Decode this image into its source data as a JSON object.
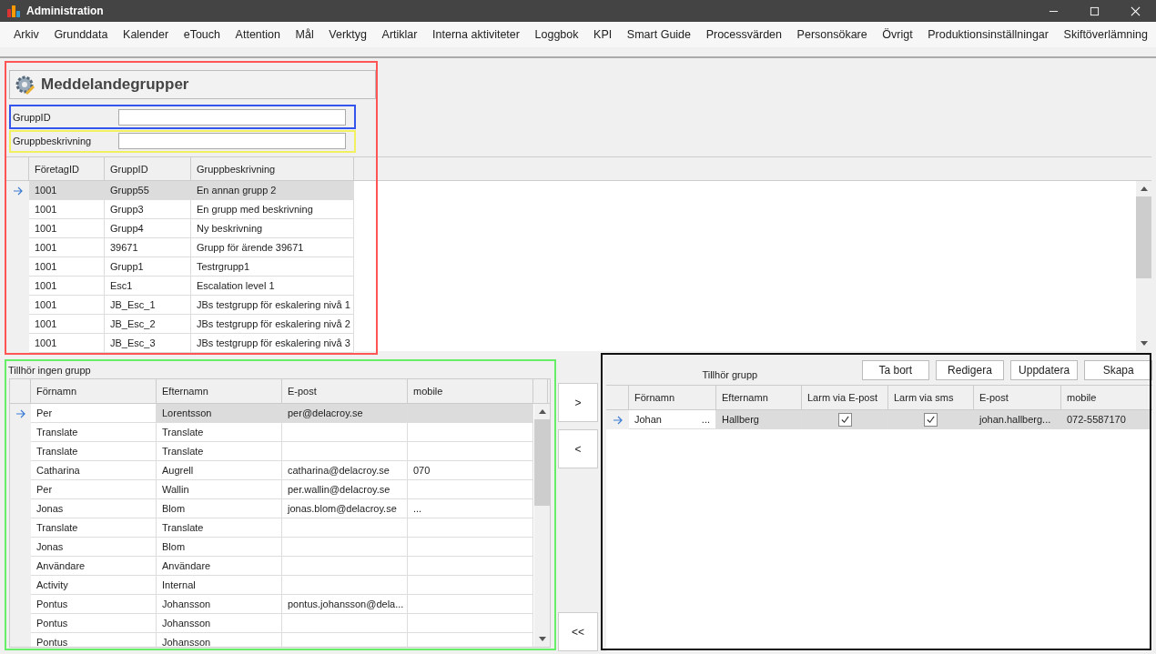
{
  "window": {
    "title": "Administration"
  },
  "menu": [
    "Arkiv",
    "Grunddata",
    "Kalender",
    "eTouch",
    "Attention",
    "Mål",
    "Verktyg",
    "Artiklar",
    "Interna aktiviteter",
    "Loggbok",
    "KPI",
    "Smart Guide",
    "Processvärden",
    "Personsökare",
    "Övrigt",
    "Produktionsinställningar",
    "Skiftöverlämning"
  ],
  "header": {
    "title": "Meddelandegrupper"
  },
  "fields": [
    {
      "label": "GruppID"
    },
    {
      "label": "Gruppbeskrivning"
    }
  ],
  "groups_table": {
    "columns": [
      "FöretagID",
      "GruppID",
      "Gruppbeskrivning"
    ],
    "rows": [
      {
        "selected": true,
        "cells": [
          "1001",
          "Grupp55",
          "En annan grupp 2"
        ]
      },
      {
        "selected": false,
        "cells": [
          "1001",
          "Grupp3",
          "En grupp med beskrivning"
        ]
      },
      {
        "selected": false,
        "cells": [
          "1001",
          "Grupp4",
          "Ny beskrivning"
        ]
      },
      {
        "selected": false,
        "cells": [
          "1001",
          "39671",
          "Grupp för ärende 39671"
        ]
      },
      {
        "selected": false,
        "cells": [
          "1001",
          "Grupp1",
          "Testrgrupp1"
        ]
      },
      {
        "selected": false,
        "cells": [
          "1001",
          "Esc1",
          "Escalation level 1"
        ]
      },
      {
        "selected": false,
        "cells": [
          "1001",
          "JB_Esc_1",
          "JBs testgrupp för eskalering nivå 1"
        ]
      },
      {
        "selected": false,
        "cells": [
          "1001",
          "JB_Esc_2",
          "JBs testgrupp för eskalering nivå 2"
        ]
      },
      {
        "selected": false,
        "cells": [
          "1001",
          "JB_Esc_3",
          "JBs testgrupp för eskalering nivå 3"
        ]
      }
    ]
  },
  "ungrouped": {
    "title": "Tillhör ingen grupp",
    "columns": [
      "Förnamn",
      "Efternamn",
      "E-post",
      "mobile"
    ],
    "rows": [
      {
        "selected": true,
        "cells": [
          "Per",
          "Lorentsson",
          "per@delacroy.se",
          ""
        ]
      },
      {
        "selected": false,
        "cells": [
          "Translate",
          "Translate",
          "",
          ""
        ]
      },
      {
        "selected": false,
        "cells": [
          "Translate",
          "Translate",
          "",
          ""
        ]
      },
      {
        "selected": false,
        "cells": [
          "Catharina",
          "Augrell",
          "catharina@delacroy.se",
          "070"
        ]
      },
      {
        "selected": false,
        "cells": [
          "Per",
          "Wallin",
          "per.wallin@delacroy.se",
          ""
        ]
      },
      {
        "selected": false,
        "cells": [
          "Jonas",
          "Blom",
          "jonas.blom@delacroy.se",
          {
            "button": "..."
          }
        ]
      },
      {
        "selected": false,
        "cells": [
          "Translate",
          "Translate",
          "",
          ""
        ]
      },
      {
        "selected": false,
        "cells": [
          "Jonas",
          "Blom",
          "",
          ""
        ]
      },
      {
        "selected": false,
        "cells": [
          "Användare",
          "Användare",
          "",
          ""
        ]
      },
      {
        "selected": false,
        "cells": [
          "Activity",
          "Internal",
          "",
          ""
        ]
      },
      {
        "selected": false,
        "cells": [
          "Pontus",
          "Johansson",
          "pontus.johansson@dela...",
          ""
        ]
      },
      {
        "selected": false,
        "cells": [
          "Pontus",
          "Johansson",
          "",
          ""
        ]
      },
      {
        "selected": false,
        "cells": [
          "Pontus",
          "Johansson",
          "",
          ""
        ]
      }
    ]
  },
  "move_buttons": [
    ">",
    "<",
    "<<"
  ],
  "grouped": {
    "title": "Tillhör grupp",
    "buttons": [
      "Ta bort",
      "Redigera",
      "Uppdatera",
      "Skapa"
    ],
    "columns": [
      "Förnamn",
      "Efternamn",
      "Larm via E-post",
      "Larm via sms",
      "E-post",
      "mobile"
    ],
    "rows": [
      {
        "selected": true,
        "cells": [
          {
            "text": "Johan",
            "button": "..."
          },
          "Hallberg",
          {
            "checked": true
          },
          {
            "checked": true
          },
          "johan.hallberg...",
          "072-5587170"
        ]
      }
    ]
  }
}
